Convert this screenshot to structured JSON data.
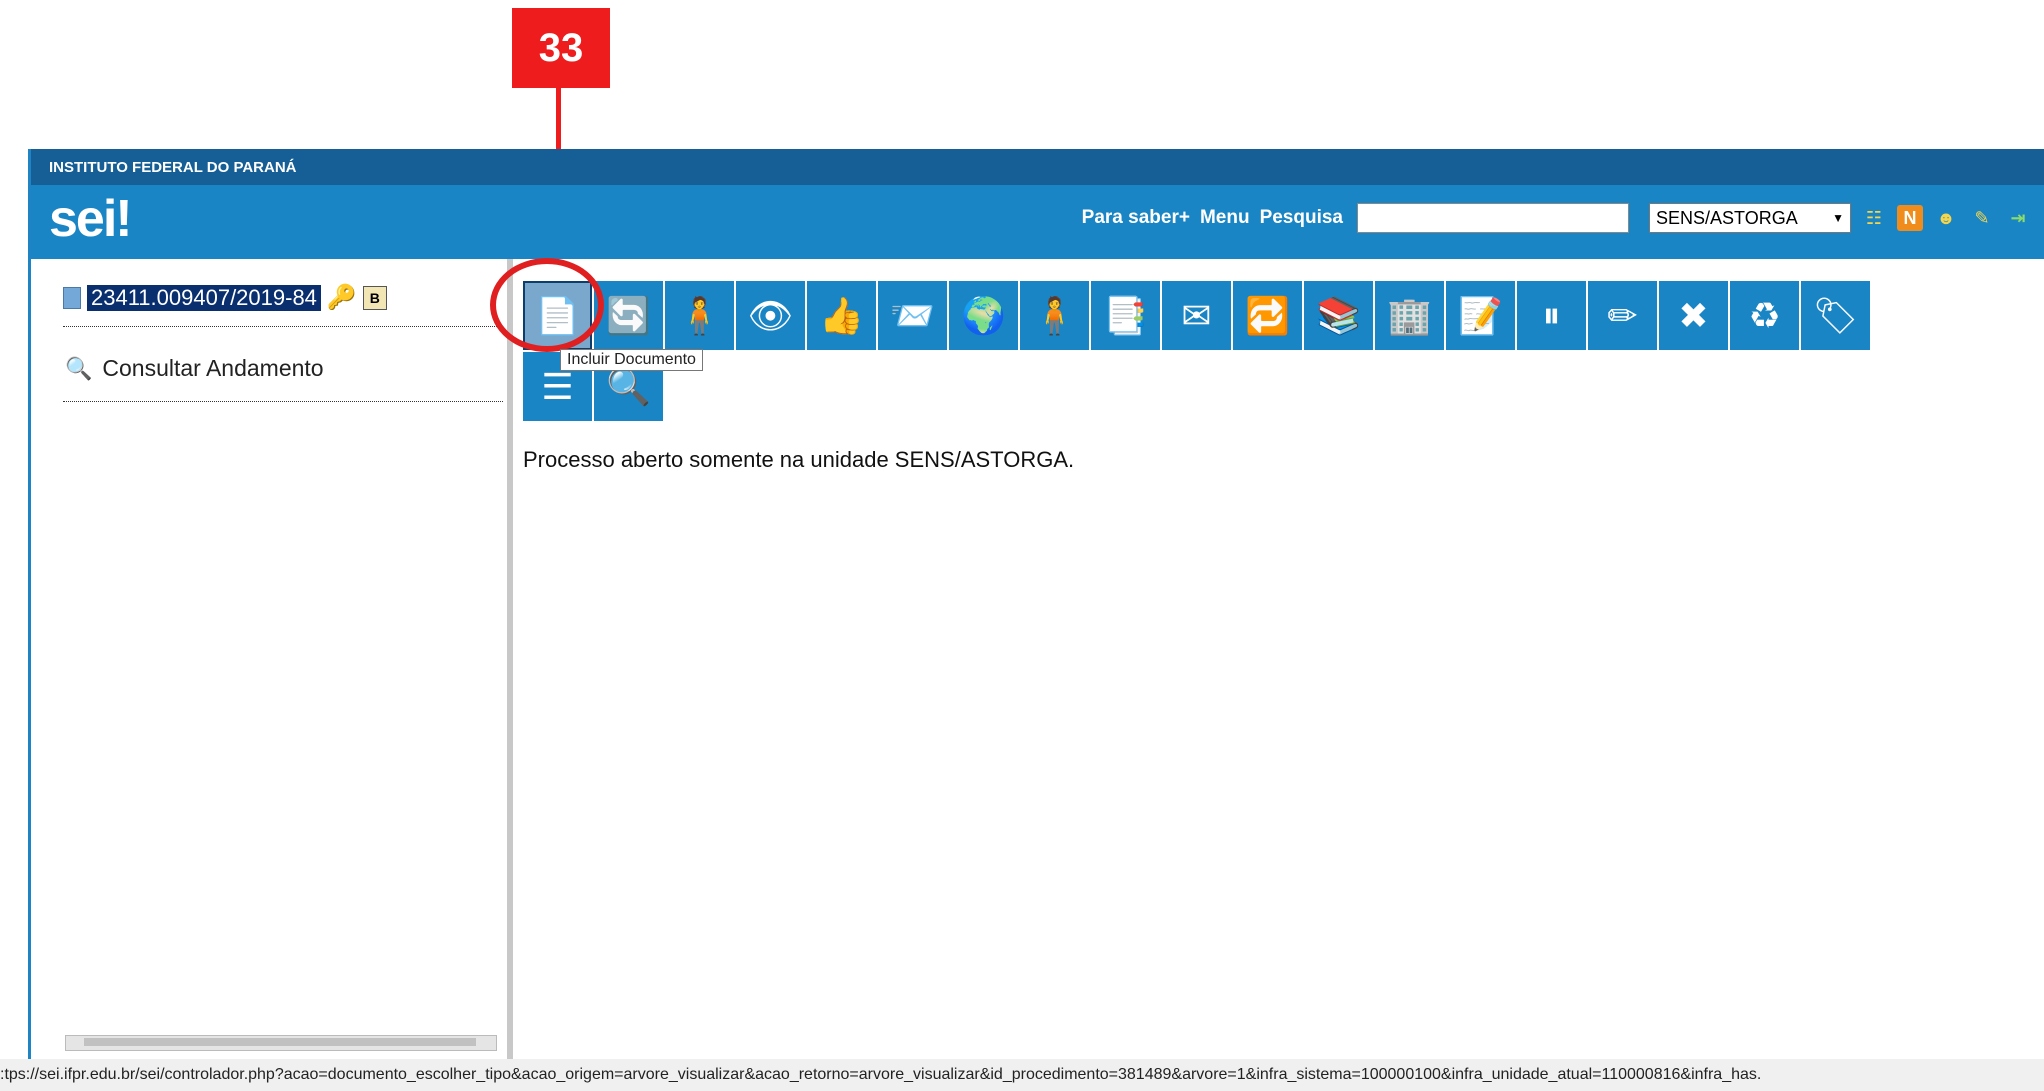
{
  "annotation": {
    "step_number": "33"
  },
  "header": {
    "institution": "INSTITUTO FEDERAL DO PARANÁ",
    "logo_text": "sei",
    "logo_bang": "!",
    "nav": {
      "para_saber": "Para saber+",
      "menu": "Menu",
      "pesquisa": "Pesquisa"
    },
    "search": {
      "value": "",
      "placeholder": ""
    },
    "unit_select": {
      "selected": "SENS/ASTORGA",
      "arrow": "▼"
    },
    "icons": [
      "list-icon",
      "n-icon",
      "user-icon",
      "tools-icon",
      "exit-icon"
    ]
  },
  "tree": {
    "process_number": "23411.009407/2019-84",
    "badge": "B",
    "consultar_label": "Consultar Andamento"
  },
  "toolbar": {
    "buttons": [
      {
        "name": "incluir-documento-button",
        "glyph": "📄"
      },
      {
        "name": "iniciar-processo-relacionado-button",
        "glyph": "🔄"
      },
      {
        "name": "atribuir-processo-button",
        "glyph": "🧍"
      },
      {
        "name": "acompanhamento-especial-button",
        "glyph": "👁"
      },
      {
        "name": "ciencia-button",
        "glyph": "👍"
      },
      {
        "name": "enviar-processo-button",
        "glyph": "📨"
      },
      {
        "name": "duplicar-processo-button",
        "glyph": "🌍"
      },
      {
        "name": "relacionamentos-button",
        "glyph": "🧍"
      },
      {
        "name": "anexar-processo-button",
        "glyph": "📑"
      },
      {
        "name": "enviar-email-button",
        "glyph": "✉"
      },
      {
        "name": "atualizar-andamento-button",
        "glyph": "🔁"
      },
      {
        "name": "gerenciar-documentos-button",
        "glyph": "📚"
      },
      {
        "name": "gerar-pdf-button",
        "glyph": "🏢"
      },
      {
        "name": "anotacoes-button",
        "glyph": "📝"
      },
      {
        "name": "sobrestar-processo-button",
        "glyph": "⏸"
      },
      {
        "name": "alterar-processo-button",
        "glyph": "✏"
      },
      {
        "name": "excluir-button",
        "glyph": "✖"
      },
      {
        "name": "concluir-processo-button",
        "glyph": "♻"
      },
      {
        "name": "marcador-button",
        "glyph": "🏷"
      },
      {
        "name": "listar-documentos-button",
        "glyph": "☰"
      },
      {
        "name": "pesquisar-processo-button",
        "glyph": "🔍"
      }
    ],
    "tooltip": "Incluir Documento"
  },
  "content": {
    "status_text": "Processo aberto somente na unidade SENS/ASTORGA."
  },
  "status_bar": {
    "url": ":tps://sei.ifpr.edu.br/sei/controlador.php?acao=documento_escolher_tipo&acao_origem=arvore_visualizar&acao_retorno=arvore_visualizar&id_procedimento=381489&arvore=1&infra_sistema=100000100&infra_unidade_atual=110000816&infra_has."
  },
  "colors": {
    "header_dark": "#155f96",
    "header_main": "#1a85c5",
    "annotation_red": "#ee1c1c"
  }
}
